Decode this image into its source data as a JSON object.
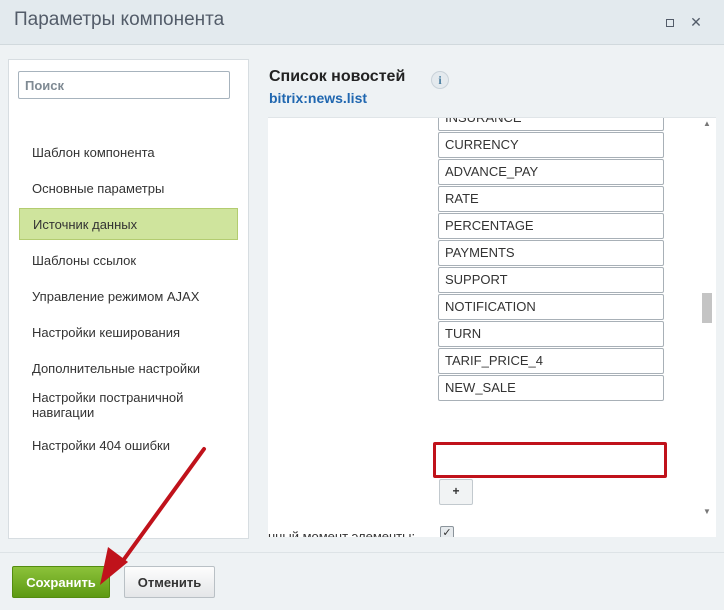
{
  "window": {
    "title": "Параметры компонента"
  },
  "search": {
    "placeholder": "Поиск"
  },
  "sidebar": {
    "items": [
      {
        "label": "Шаблон компонента"
      },
      {
        "label": "Основные параметры"
      },
      {
        "label": "Источник данных",
        "active": true
      },
      {
        "label": "Шаблоны ссылок"
      },
      {
        "label": "Управление режимом AJAX"
      },
      {
        "label": "Настройки кеширования"
      },
      {
        "label": "Дополнительные настройки"
      },
      {
        "label": "Настройки постраничной навигации"
      },
      {
        "label": "Настройки 404 ошибки"
      }
    ]
  },
  "component": {
    "title": "Список новостей",
    "code": "bitrix:news.list",
    "info_glyph": "i"
  },
  "properties": {
    "values": [
      "INSURANCE",
      "CURRENCY",
      "ADVANCE_PAY",
      "RATE",
      "PERCENTAGE",
      "PAYMENTS",
      "SUPPORT",
      "NOTIFICATION",
      "TURN",
      "TARIF_PRICE_4",
      "NEW_SALE"
    ],
    "highlighted": "NEW_SALE",
    "add_label": "+"
  },
  "checkbox_row": {
    "label": "нный момент элементы:",
    "checked": true,
    "check_glyph": "✓"
  },
  "footer": {
    "save_label": "Сохранить",
    "cancel_label": "Отменить"
  },
  "colors": {
    "active_nav": "#cfe49d",
    "highlight_border": "#c0121b",
    "save_button": "#6aa81f",
    "code_link": "#2067b0",
    "annotation_arrow": "#c0121b"
  }
}
